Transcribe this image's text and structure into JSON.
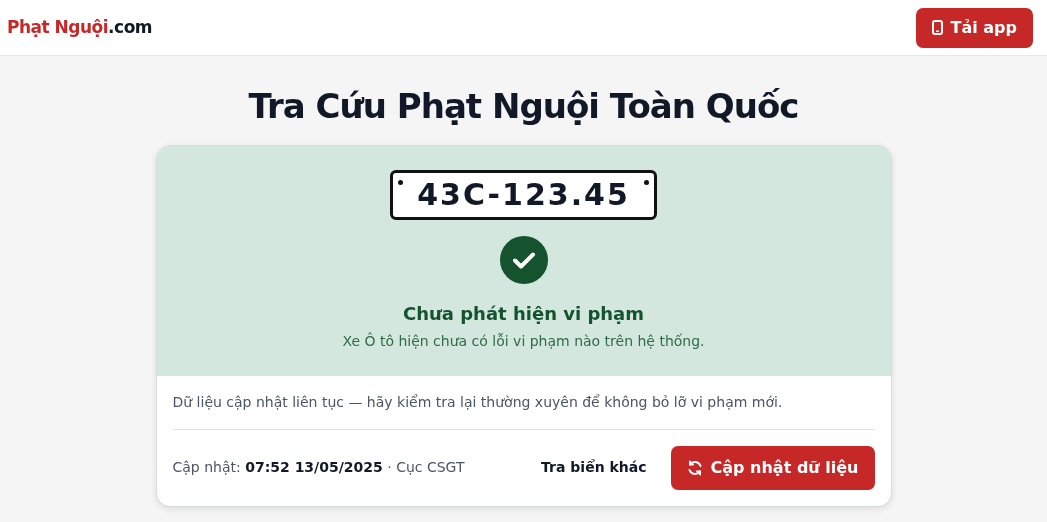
{
  "header": {
    "logo": {
      "brand": "Phạt Nguội",
      "suffix": ".com"
    },
    "app_button": "Tải app"
  },
  "title": "Tra Cứu Phạt Nguội Toàn Quốc",
  "result": {
    "plate": "43C-123.45",
    "status": {
      "kind": "clear",
      "heading": "Chưa phát hiện vi phạm",
      "message": "Xe Ô tô hiện chưa có lỗi vi phạm nào trên hệ thống."
    },
    "note": "Dữ liệu cập nhật liên tục — hãy kiểm tra lại thường xuyên để không bỏ lỡ vi phạm mới.",
    "updated": "Cập nhật: **07:52 13/05/2025** · Cục CSGT",
    "other_plate_link": "Tra biển khác",
    "refresh_button": "Cập nhật dữ liệu"
  }
}
